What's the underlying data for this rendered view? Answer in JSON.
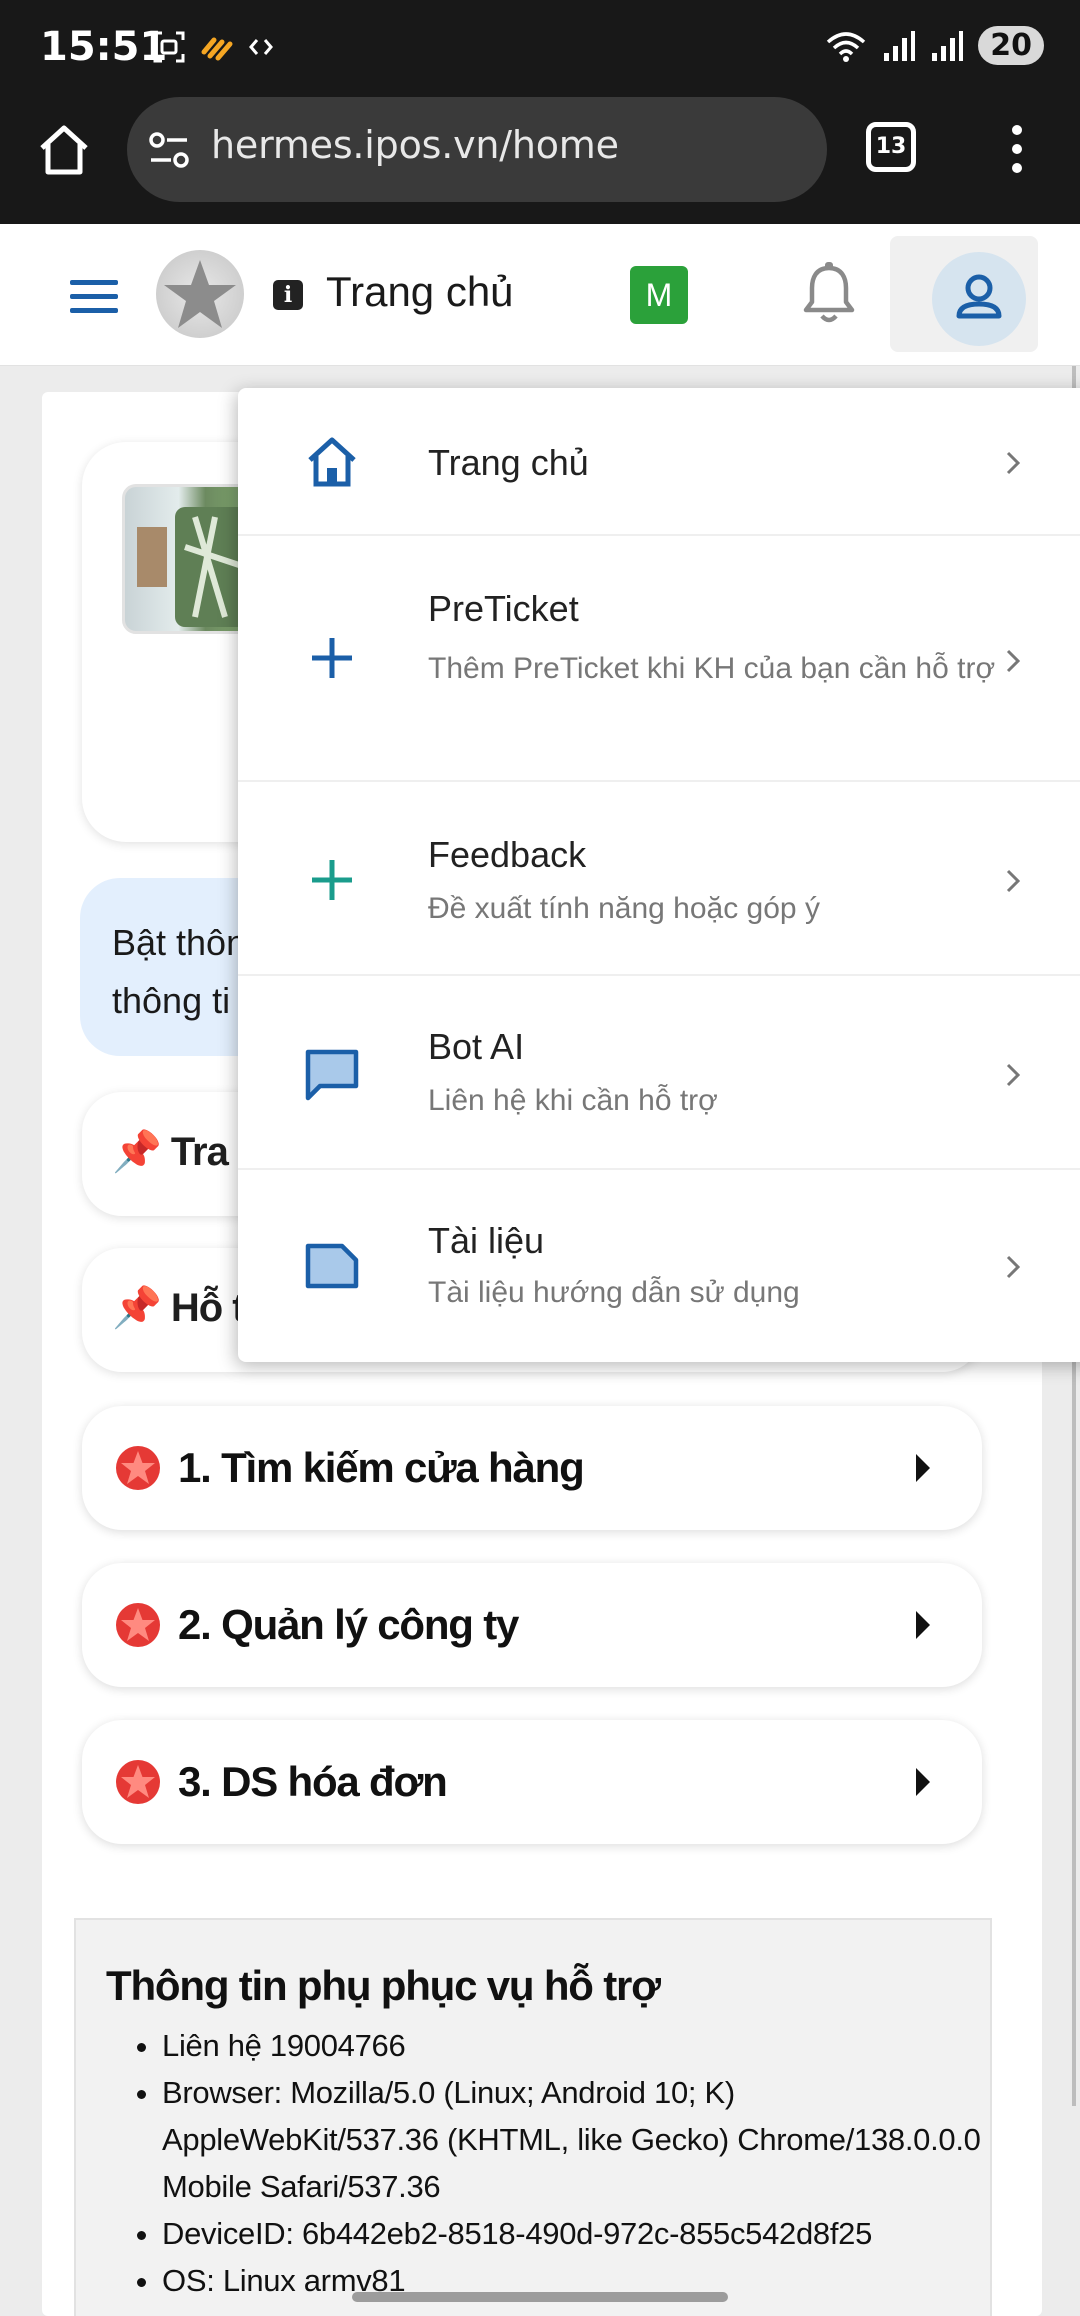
{
  "status_bar": {
    "time": "15:51",
    "battery": "20"
  },
  "browser": {
    "url": "hermes.ipos.vn/home",
    "tab_count": "13"
  },
  "header": {
    "title": "Trang chủ",
    "avatar_letter": "M"
  },
  "menu": {
    "items": [
      {
        "title": "Trang chủ",
        "subtitle": "",
        "icon": "home-icon"
      },
      {
        "title": "PreTicket",
        "subtitle": "Thêm PreTicket khi KH của bạn cần hỗ trợ",
        "icon": "plus-icon"
      },
      {
        "title": "Feedback",
        "subtitle": "Đề xuất tính năng hoặc góp ý",
        "icon": "plus-icon"
      },
      {
        "title": "Bot AI",
        "subtitle": "Liên hệ khi cần hỗ trợ",
        "icon": "chat-icon"
      },
      {
        "title": "Tài liệu",
        "subtitle": "Tài liệu hướng dẫn sử dụng",
        "icon": "folder-icon"
      }
    ]
  },
  "content": {
    "notice_line1": "Bật thôn",
    "notice_line2": "thông ti",
    "pin_cards": [
      {
        "label": "Tra c"
      },
      {
        "label": "Hỗ t"
      }
    ],
    "nav_cards": [
      {
        "label": "1. Tìm kiếm cửa hàng"
      },
      {
        "label": "2. Quản lý công ty"
      },
      {
        "label": "3. DS hóa đơn"
      }
    ],
    "support": {
      "title": "Thông tin phụ phục vụ hỗ trợ",
      "items": [
        "Liên hệ 19004766",
        "Browser: Mozilla/5.0 (Linux; Android 10; K) AppleWebKit/537.36 (KHTML, like Gecko) Chrome/138.0.0.0 Mobile Safari/537.36",
        "DeviceID: 6b442eb2-8518-490d-972c-855c542d8f25",
        "OS: Linux armv81"
      ]
    }
  },
  "colors": {
    "accent_blue": "#1b5fa8",
    "accent_teal": "#1a9c8c",
    "green_avatar": "#2ba13a",
    "star_red": "#e53935",
    "notice_bg": "#e3effd"
  }
}
